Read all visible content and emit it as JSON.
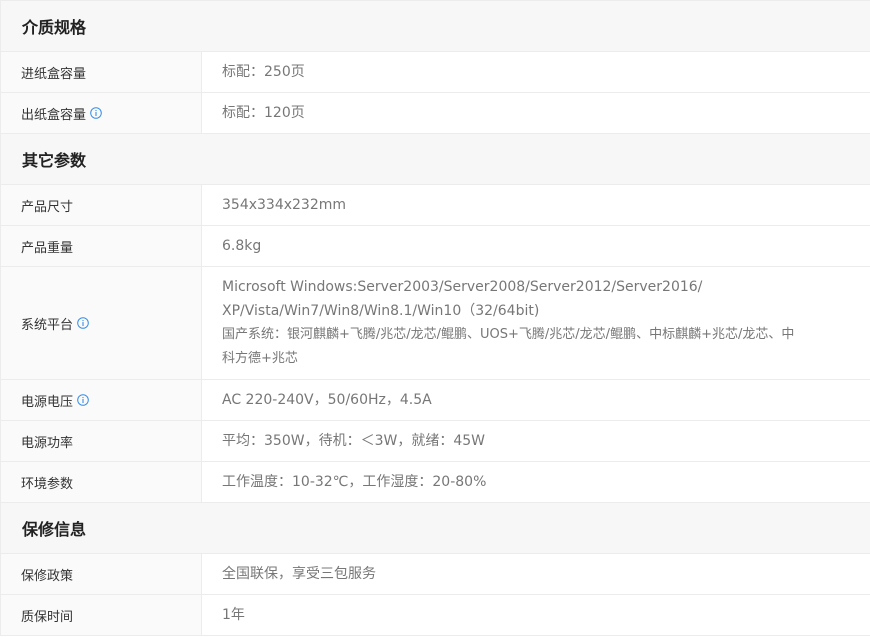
{
  "accent_color": "#3a8ee6",
  "sections": [
    {
      "title": "介质规格",
      "rows": [
        {
          "label": "进纸盒容量",
          "info": false,
          "value": "标配：250页"
        },
        {
          "label": "出纸盒容量",
          "info": true,
          "value": "标配：120页"
        }
      ]
    },
    {
      "title": "其它参数",
      "rows": [
        {
          "label": "产品尺寸",
          "info": false,
          "value": "354x334x232mm"
        },
        {
          "label": "产品重量",
          "info": false,
          "value": "6.8kg"
        },
        {
          "label": "系统平台",
          "info": true,
          "lines": [
            "Microsoft Windows:Server2003/Server2008/Server2012/Server2016/",
            "XP/Vista/Win7/Win8/Win8.1/Win10（32/64bit)",
            "国产系统：银河麒麟+飞腾/兆芯/龙芯/鲲鹏、UOS+飞腾/兆芯/龙芯/鲲鹏、中标麒麟+兆芯/龙芯、中",
            "科方德+兆芯"
          ]
        },
        {
          "label": "电源电压",
          "info": true,
          "value": "AC 220-240V，50/60Hz，4.5A"
        },
        {
          "label": "电源功率",
          "info": false,
          "value": "平均：350W，待机：＜3W，就绪：45W"
        },
        {
          "label": "环境参数",
          "info": false,
          "value": "工作温度：10-32℃，工作湿度：20-80%"
        }
      ]
    },
    {
      "title": "保修信息",
      "rows": [
        {
          "label": "保修政策",
          "info": false,
          "value": "全国联保，享受三包服务"
        },
        {
          "label": "质保时间",
          "info": false,
          "value": "1年"
        }
      ]
    }
  ]
}
